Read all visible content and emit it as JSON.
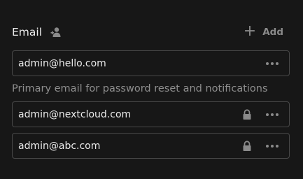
{
  "section": {
    "title": "Email",
    "add_label": "Add",
    "helper_text": "Primary email for password reset and notifications"
  },
  "emails": [
    {
      "value": "admin@hello.com",
      "locked": false
    },
    {
      "value": "admin@nextcloud.com",
      "locked": true
    },
    {
      "value": "admin@abc.com",
      "locked": true
    }
  ],
  "icons": {
    "scope": "contacts-scope-icon",
    "add": "plus-icon",
    "lock": "lock-icon",
    "menu": "more-actions-icon"
  },
  "colors": {
    "background": "#171717",
    "border": "#484848",
    "text": "#ebebeb",
    "muted": "#8a8a8a"
  }
}
